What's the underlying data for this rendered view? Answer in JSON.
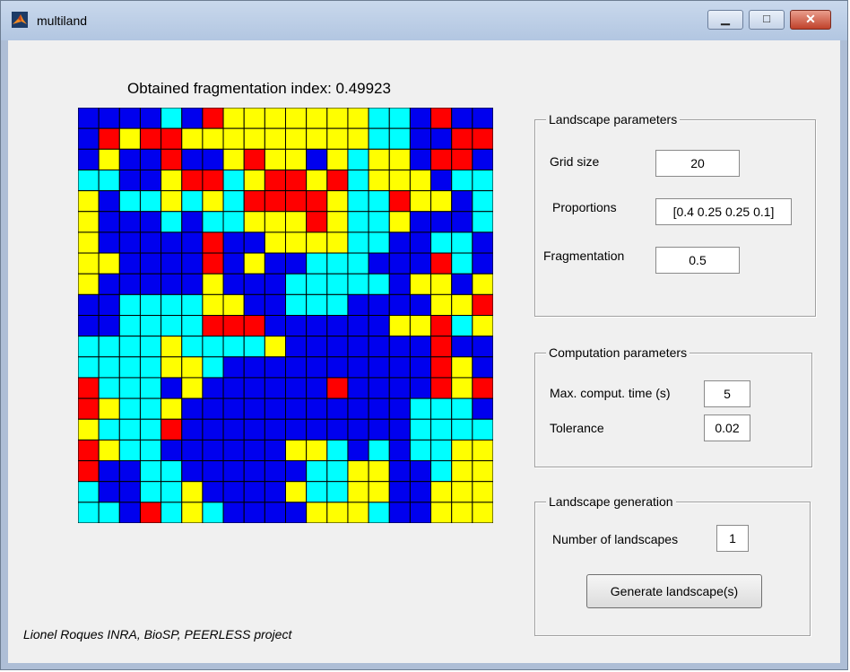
{
  "window": {
    "title": "multiland",
    "minimize_icon": "minimize-icon",
    "maximize_icon": "maximize-icon",
    "close_icon": "close-icon"
  },
  "grid": {
    "title": "Obtained fragmentation index: 0.49923",
    "size": 20,
    "colors": {
      "B": "#0000ee",
      "C": "#00ffff",
      "Y": "#ffff00",
      "R": "#ff0000"
    },
    "rows": [
      "BBBBCBRYYYYYYYCCBRBB",
      "BRYRRYYYYYYYYYCCBBRR",
      "BYBBRBBYRYYBYCYYBRRB",
      "CCBBYRRCYRRYRCYYYBCC",
      "YBCCYCYCRRRRYCCRYYBC",
      "YBBBCBCCYYYRYCCYBBBC",
      "YBBBBBRBBYYYYCCBBCCB",
      "YYBBBBRBYBBCCCBBBRCB",
      "YBBBBBYBBBCCCCCBYYBY",
      "BBCCCCYYBBCCCBBBBYYR",
      "BBCCCCRRRBBBBBBYYRCY",
      "CCCCYCCCCYBBBBBBBRBB",
      "CCCCYYCBBBBBBBBBBRYB",
      "RCCCBYBBBBBBRBBBBRYR",
      "RYCCYBBBBBBBBBBBCCCB",
      "YCCCRBBBBBBBBBBBCCCC",
      "RYCCBBBBBBYYCBCBCCYY",
      "RBBCCBBBBBBCCYYBBCYY",
      "CBBCCYBBBBYCCYYBBYYY",
      "CCBRCYCBBBBYYYCBBYYY"
    ]
  },
  "landscape_parameters": {
    "title": "Landscape parameters",
    "grid_size_label": "Grid size",
    "grid_size_value": "20",
    "proportions_label": "Proportions",
    "proportions_value": "[0.4 0.25 0.25 0.1]",
    "fragmentation_label": "Fragmentation",
    "fragmentation_value": "0.5"
  },
  "computation_parameters": {
    "title": "Computation parameters",
    "max_time_label": "Max. comput. time (s)",
    "max_time_value": "5",
    "tolerance_label": "Tolerance",
    "tolerance_value": "0.02"
  },
  "landscape_generation": {
    "title": "Landscape generation",
    "num_label": "Number of landscapes",
    "num_value": "1",
    "generate_button": "Generate landscape(s)"
  },
  "credit": "Lionel Roques INRA, BioSP, PEERLESS project"
}
